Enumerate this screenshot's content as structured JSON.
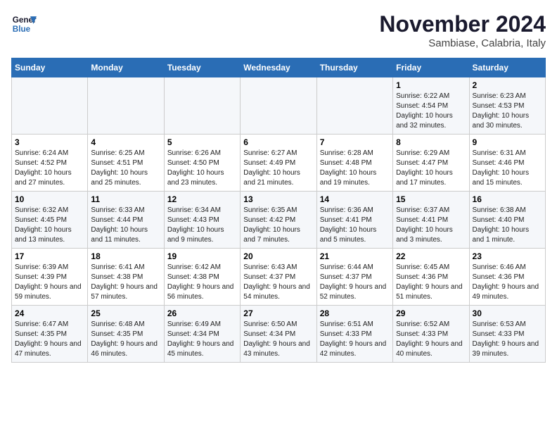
{
  "header": {
    "logo_line1": "General",
    "logo_line2": "Blue",
    "month_title": "November 2024",
    "location": "Sambiase, Calabria, Italy"
  },
  "weekdays": [
    "Sunday",
    "Monday",
    "Tuesday",
    "Wednesday",
    "Thursday",
    "Friday",
    "Saturday"
  ],
  "weeks": [
    [
      {
        "day": "",
        "info": ""
      },
      {
        "day": "",
        "info": ""
      },
      {
        "day": "",
        "info": ""
      },
      {
        "day": "",
        "info": ""
      },
      {
        "day": "",
        "info": ""
      },
      {
        "day": "1",
        "info": "Sunrise: 6:22 AM\nSunset: 4:54 PM\nDaylight: 10 hours and 32 minutes."
      },
      {
        "day": "2",
        "info": "Sunrise: 6:23 AM\nSunset: 4:53 PM\nDaylight: 10 hours and 30 minutes."
      }
    ],
    [
      {
        "day": "3",
        "info": "Sunrise: 6:24 AM\nSunset: 4:52 PM\nDaylight: 10 hours and 27 minutes."
      },
      {
        "day": "4",
        "info": "Sunrise: 6:25 AM\nSunset: 4:51 PM\nDaylight: 10 hours and 25 minutes."
      },
      {
        "day": "5",
        "info": "Sunrise: 6:26 AM\nSunset: 4:50 PM\nDaylight: 10 hours and 23 minutes."
      },
      {
        "day": "6",
        "info": "Sunrise: 6:27 AM\nSunset: 4:49 PM\nDaylight: 10 hours and 21 minutes."
      },
      {
        "day": "7",
        "info": "Sunrise: 6:28 AM\nSunset: 4:48 PM\nDaylight: 10 hours and 19 minutes."
      },
      {
        "day": "8",
        "info": "Sunrise: 6:29 AM\nSunset: 4:47 PM\nDaylight: 10 hours and 17 minutes."
      },
      {
        "day": "9",
        "info": "Sunrise: 6:31 AM\nSunset: 4:46 PM\nDaylight: 10 hours and 15 minutes."
      }
    ],
    [
      {
        "day": "10",
        "info": "Sunrise: 6:32 AM\nSunset: 4:45 PM\nDaylight: 10 hours and 13 minutes."
      },
      {
        "day": "11",
        "info": "Sunrise: 6:33 AM\nSunset: 4:44 PM\nDaylight: 10 hours and 11 minutes."
      },
      {
        "day": "12",
        "info": "Sunrise: 6:34 AM\nSunset: 4:43 PM\nDaylight: 10 hours and 9 minutes."
      },
      {
        "day": "13",
        "info": "Sunrise: 6:35 AM\nSunset: 4:42 PM\nDaylight: 10 hours and 7 minutes."
      },
      {
        "day": "14",
        "info": "Sunrise: 6:36 AM\nSunset: 4:41 PM\nDaylight: 10 hours and 5 minutes."
      },
      {
        "day": "15",
        "info": "Sunrise: 6:37 AM\nSunset: 4:41 PM\nDaylight: 10 hours and 3 minutes."
      },
      {
        "day": "16",
        "info": "Sunrise: 6:38 AM\nSunset: 4:40 PM\nDaylight: 10 hours and 1 minute."
      }
    ],
    [
      {
        "day": "17",
        "info": "Sunrise: 6:39 AM\nSunset: 4:39 PM\nDaylight: 9 hours and 59 minutes."
      },
      {
        "day": "18",
        "info": "Sunrise: 6:41 AM\nSunset: 4:38 PM\nDaylight: 9 hours and 57 minutes."
      },
      {
        "day": "19",
        "info": "Sunrise: 6:42 AM\nSunset: 4:38 PM\nDaylight: 9 hours and 56 minutes."
      },
      {
        "day": "20",
        "info": "Sunrise: 6:43 AM\nSunset: 4:37 PM\nDaylight: 9 hours and 54 minutes."
      },
      {
        "day": "21",
        "info": "Sunrise: 6:44 AM\nSunset: 4:37 PM\nDaylight: 9 hours and 52 minutes."
      },
      {
        "day": "22",
        "info": "Sunrise: 6:45 AM\nSunset: 4:36 PM\nDaylight: 9 hours and 51 minutes."
      },
      {
        "day": "23",
        "info": "Sunrise: 6:46 AM\nSunset: 4:36 PM\nDaylight: 9 hours and 49 minutes."
      }
    ],
    [
      {
        "day": "24",
        "info": "Sunrise: 6:47 AM\nSunset: 4:35 PM\nDaylight: 9 hours and 47 minutes."
      },
      {
        "day": "25",
        "info": "Sunrise: 6:48 AM\nSunset: 4:35 PM\nDaylight: 9 hours and 46 minutes."
      },
      {
        "day": "26",
        "info": "Sunrise: 6:49 AM\nSunset: 4:34 PM\nDaylight: 9 hours and 45 minutes."
      },
      {
        "day": "27",
        "info": "Sunrise: 6:50 AM\nSunset: 4:34 PM\nDaylight: 9 hours and 43 minutes."
      },
      {
        "day": "28",
        "info": "Sunrise: 6:51 AM\nSunset: 4:33 PM\nDaylight: 9 hours and 42 minutes."
      },
      {
        "day": "29",
        "info": "Sunrise: 6:52 AM\nSunset: 4:33 PM\nDaylight: 9 hours and 40 minutes."
      },
      {
        "day": "30",
        "info": "Sunrise: 6:53 AM\nSunset: 4:33 PM\nDaylight: 9 hours and 39 minutes."
      }
    ]
  ]
}
